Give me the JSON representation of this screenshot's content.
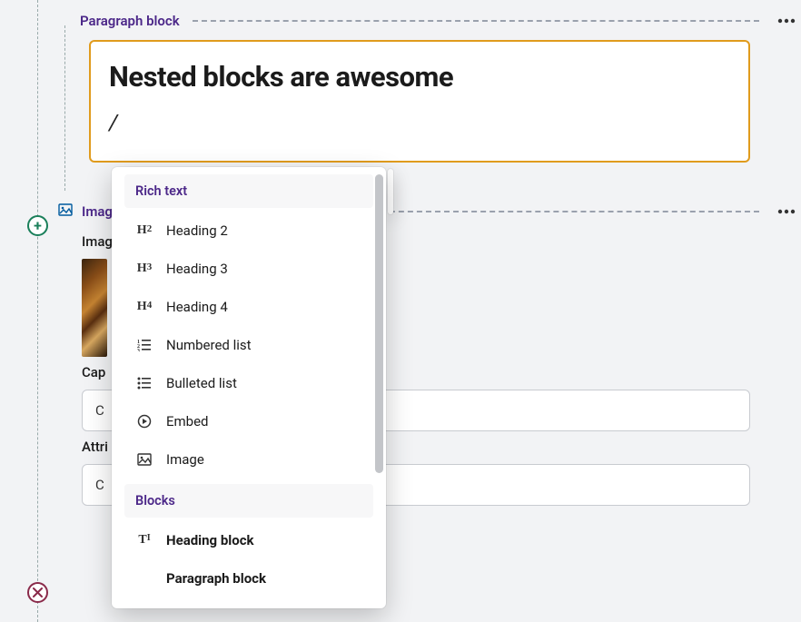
{
  "colors": {
    "accent": "#4c2889",
    "card_border": "#e09b1d",
    "add": "#1a7f5a",
    "remove": "#8a2a4a"
  },
  "paragraph_block": {
    "label": "Paragraph block",
    "heading_text": "Nested blocks are awesome",
    "slash_trigger": "/"
  },
  "add_button": {
    "label": "+"
  },
  "image_block": {
    "label": "Imag",
    "field_image_label": "Imag",
    "field_caption_label": "Cap",
    "caption_visible_value": "C",
    "field_attr_label": "Attri",
    "attr_visible_value": "C"
  },
  "slash_menu": {
    "section_rich_text": "Rich text",
    "items_rich": [
      {
        "icon_label": "H2",
        "label": "Heading 2"
      },
      {
        "icon_label": "H3",
        "label": "Heading 3"
      },
      {
        "icon_label": "H4",
        "label": "Heading 4"
      },
      {
        "icon_label": "ol",
        "label": "Numbered list"
      },
      {
        "icon_label": "ul",
        "label": "Bulleted list"
      },
      {
        "icon_label": "embed",
        "label": "Embed"
      },
      {
        "icon_label": "image",
        "label": "Image"
      }
    ],
    "section_blocks": "Blocks",
    "items_blocks": [
      {
        "icon_label": "T",
        "label": "Heading block"
      },
      {
        "icon_label": "",
        "label": "Paragraph block"
      }
    ]
  }
}
